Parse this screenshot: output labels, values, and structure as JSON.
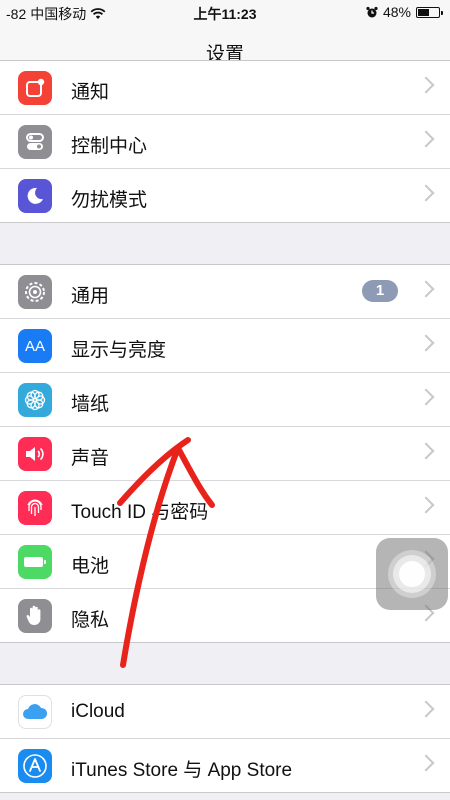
{
  "status_bar": {
    "signal": "-82",
    "carrier": "中国移动",
    "time": "上午11:23",
    "battery": "48%",
    "battery_level": 0.48,
    "icons": [
      "wifi-icon",
      "alarm-icon",
      "battery-icon"
    ]
  },
  "nav": {
    "title": "设置"
  },
  "groups": [
    {
      "items": [
        {
          "label": "通知",
          "icon": "notifications-icon",
          "color": "#f44336"
        },
        {
          "label": "控制中心",
          "icon": "control-center-icon",
          "color": "#8e8e93"
        },
        {
          "label": "勿扰模式",
          "icon": "do-not-disturb-icon",
          "color": "#5856d6"
        }
      ]
    },
    {
      "items": [
        {
          "label": "通用",
          "icon": "gear-icon",
          "color": "#8e8e93",
          "badge": "1"
        },
        {
          "label": "显示与亮度",
          "icon": "display-brightness-icon",
          "color": "#1a7cf5",
          "icon_text": "AA"
        },
        {
          "label": "墙纸",
          "icon": "wallpaper-icon",
          "color": "#34aadc"
        },
        {
          "label": "声音",
          "icon": "sound-icon",
          "color": "#ff2d55"
        },
        {
          "label": "Touch ID 与密码",
          "icon": "fingerprint-icon",
          "color": "#ff2d55"
        },
        {
          "label": "电池",
          "icon": "battery-setting-icon",
          "color": "#4cd964"
        },
        {
          "label": "隐私",
          "icon": "privacy-hand-icon",
          "color": "#8e8e93"
        }
      ]
    },
    {
      "items": [
        {
          "label": "iCloud",
          "icon": "icloud-icon",
          "color": "#ffffff"
        },
        {
          "label": "iTunes Store 与 App Store",
          "icon": "app-store-icon",
          "color": "#1a8cf0"
        }
      ]
    }
  ],
  "colors": {
    "annotation": "#e8231b",
    "background": "#efeff4"
  }
}
